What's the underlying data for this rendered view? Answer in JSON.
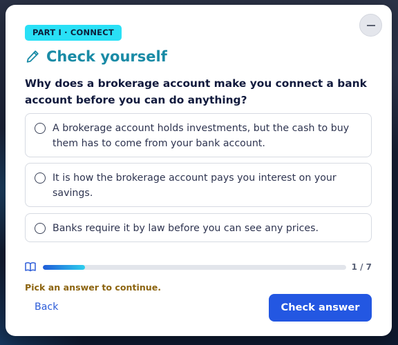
{
  "badge": {
    "label": "PART I · CONNECT"
  },
  "header": {
    "icon": "pencil-icon",
    "title": "Check yourself",
    "collapse_icon": "minus-icon"
  },
  "question": {
    "text": "Why does a brokerage account make you connect a bank account before you can do anything?"
  },
  "options": [
    {
      "text": "A brokerage account holds investments, but the cash to buy them has to come from your bank account.",
      "selected": false
    },
    {
      "text": "It is how the brokerage account pays you interest on your savings.",
      "selected": false
    },
    {
      "text": "Banks require it by law before you can see any prices.",
      "selected": false
    }
  ],
  "progress": {
    "icon": "book-icon",
    "current": 1,
    "total": 7,
    "label": "1 / 7",
    "fill_fraction": 0.14
  },
  "footer": {
    "hint": "Pick an answer to continue.",
    "back_label": "Back",
    "check_label": "Check answer"
  },
  "colors": {
    "accent": "#2357e2",
    "title": "#1a8ba6",
    "badge_bg": "#29e0f6",
    "hint": "#8c6410",
    "progress_start": "#1f5bd8",
    "progress_end": "#2ecfee"
  }
}
